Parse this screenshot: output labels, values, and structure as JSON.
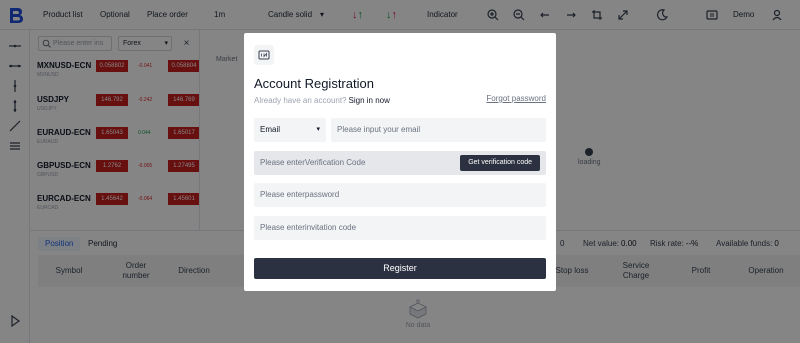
{
  "toolbar": {
    "product_list": "Product list",
    "optional": "Optional",
    "place_order": "Place order",
    "interval": "1m",
    "chart_type": "Candle solid",
    "indicator": "Indicator",
    "account_mode": "Demo",
    "colors": {
      "up": "#16a34a",
      "down": "#e11d48"
    }
  },
  "products": {
    "search_placeholder": "Please enter ins",
    "category": "Forex",
    "items": [
      {
        "symbol": "MXNUSD-ECN",
        "sub": "MXNUSD",
        "bid": "0.058802",
        "change": "-0.041",
        "ask": "0.058804"
      },
      {
        "symbol": "USDJPY",
        "sub": "USDJPY",
        "bid": "146.792",
        "change": "-0.242",
        "ask": "146.769"
      },
      {
        "symbol": "EURAUD-ECN",
        "sub": "EURAUD",
        "bid": "1.65043",
        "change": "0.044",
        "ask": "1.65017"
      },
      {
        "symbol": "GBPUSD-ECN",
        "sub": "GBPUSD",
        "bid": "1.2762",
        "change": "-0.005",
        "ask": "1.27495"
      },
      {
        "symbol": "EURCAD-ECN",
        "sub": "EURCAD",
        "bid": "1.45642",
        "change": "-0.064",
        "ask": "1.45601"
      }
    ]
  },
  "chart": {
    "tab": "Market",
    "loading": "loading"
  },
  "positions": {
    "tabs": [
      "Position",
      "Pending"
    ],
    "stats": {
      "balance_value": "0",
      "net_value_label": "Net value:",
      "net_value": "0.00",
      "risk_rate_label": "Risk rate:",
      "risk_rate": "--%",
      "available_funds_label": "Available funds:",
      "available_funds": "0"
    },
    "columns": [
      "Symbol",
      "Order number",
      "Direction",
      "Stop loss",
      "Service Charge",
      "Profit",
      "Operation"
    ],
    "empty": "No data"
  },
  "modal": {
    "title": "Account Registration",
    "have_account": "Already have an account?",
    "sign_in": "Sign in now",
    "forgot_password": "Forgot password",
    "method": "Email",
    "email_placeholder": "Please input your email",
    "code_placeholder": "Please enterVerification Code",
    "get_code": "Get verification code",
    "password_placeholder": "Please enterpassword",
    "invitation_placeholder": "Please enterinvitation code",
    "register": "Register"
  }
}
